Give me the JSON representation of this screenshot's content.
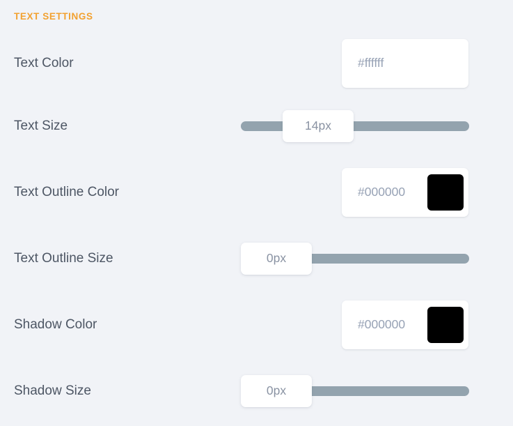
{
  "section": {
    "title": "TEXT SETTINGS",
    "accent_color": "#f2a130"
  },
  "theme": {
    "background": "#f1f3f7",
    "card_background": "#ffffff",
    "label_color": "#4d5664",
    "value_color": "#8a93a3",
    "slider_track_color": "#93a3ae"
  },
  "rows": [
    {
      "label": "Text Color",
      "type": "color",
      "value": "#ffffff",
      "placeholder": "#ffffff",
      "swatch_color": "#ffffff"
    },
    {
      "label": "Text Size",
      "type": "slider",
      "value": "14px",
      "thumb_percent": 26.5
    },
    {
      "label": "Text Outline Color",
      "type": "color",
      "value": "#000000",
      "placeholder": "#000000",
      "swatch_color": "#000000"
    },
    {
      "label": "Text Outline Size",
      "type": "slider",
      "value": "0px",
      "thumb_percent": 0
    },
    {
      "label": "Shadow Color",
      "type": "color",
      "value": "#000000",
      "placeholder": "#000000",
      "swatch_color": "#000000"
    },
    {
      "label": "Shadow Size",
      "type": "slider",
      "value": "0px",
      "thumb_percent": 0
    }
  ]
}
